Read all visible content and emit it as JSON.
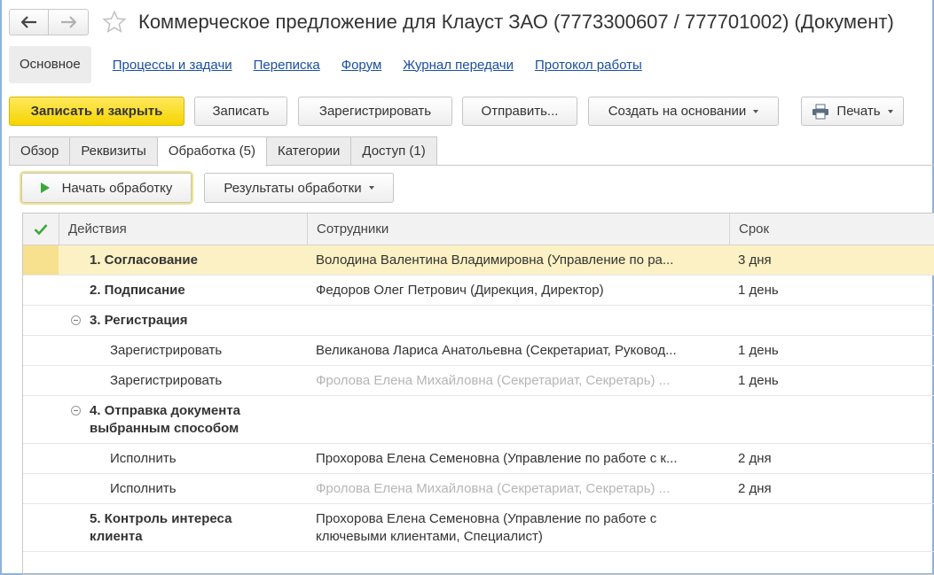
{
  "window": {
    "title": "Коммерческое предложение для Клауст ЗАО (7773300607 / 777701002) (Документ)",
    "back_icon": "arrow-left-icon",
    "forward_icon": "arrow-right-icon",
    "favorite_icon": "star-icon"
  },
  "sections": {
    "active": "Основное",
    "links": [
      "Процессы и задачи",
      "Переписка",
      "Форум",
      "Журнал передачи",
      "Протокол работы"
    ]
  },
  "toolbar": {
    "save_close": "Записать и закрыть",
    "save": "Записать",
    "register": "Зарегистрировать",
    "send": "Отправить...",
    "create_based": "Создать на основании",
    "print": "Печать"
  },
  "tabs": [
    "Обзор",
    "Реквизиты",
    "Обработка (5)",
    "Категории",
    "Доступ (1)"
  ],
  "processing": {
    "start": "Начать обработку",
    "results": "Результаты обработки"
  },
  "table": {
    "headers": {
      "actions": "Действия",
      "employees": "Сотрудники",
      "term": "Срок"
    },
    "rows": [
      {
        "action": "1. Согласование",
        "employee": "Володина Валентина Владимировна (Управление по ра...",
        "term": "3 дня"
      },
      {
        "action": "2. Подписание",
        "employee": "Федоров Олег Петрович (Дирекция, Директор)",
        "term": "1 день"
      },
      {
        "action": "3. Регистрация",
        "employee": "",
        "term": ""
      },
      {
        "action": "Зарегистрировать",
        "employee": "Великанова Лариса Анатольевна (Секретариат, Руковод...",
        "term": "1 день"
      },
      {
        "action": "Зарегистрировать",
        "employee": "Фролова Елена Михайловна (Секретариат, Секретарь) ...",
        "term": "1 день"
      },
      {
        "action": "4. Отправка документа выбранным способом",
        "employee": "",
        "term": ""
      },
      {
        "action": "Исполнить",
        "employee": "Прохорова Елена Семеновна (Управление по работе с к...",
        "term": "2 дня"
      },
      {
        "action": "Исполнить",
        "employee": "Фролова Елена Михайловна (Секретариат, Секретарь) ...",
        "term": "2 дня"
      },
      {
        "action": "5. Контроль интереса клиента",
        "employee": "Прохорова Елена Семеновна (Управление по работе с ключевыми клиентами, Специалист)",
        "term": ""
      }
    ]
  },
  "colors": {
    "primary_button": "#f5d400",
    "selected_row": "#fbf1c4",
    "link": "#1a4fa0",
    "check": "#3aa83a"
  }
}
